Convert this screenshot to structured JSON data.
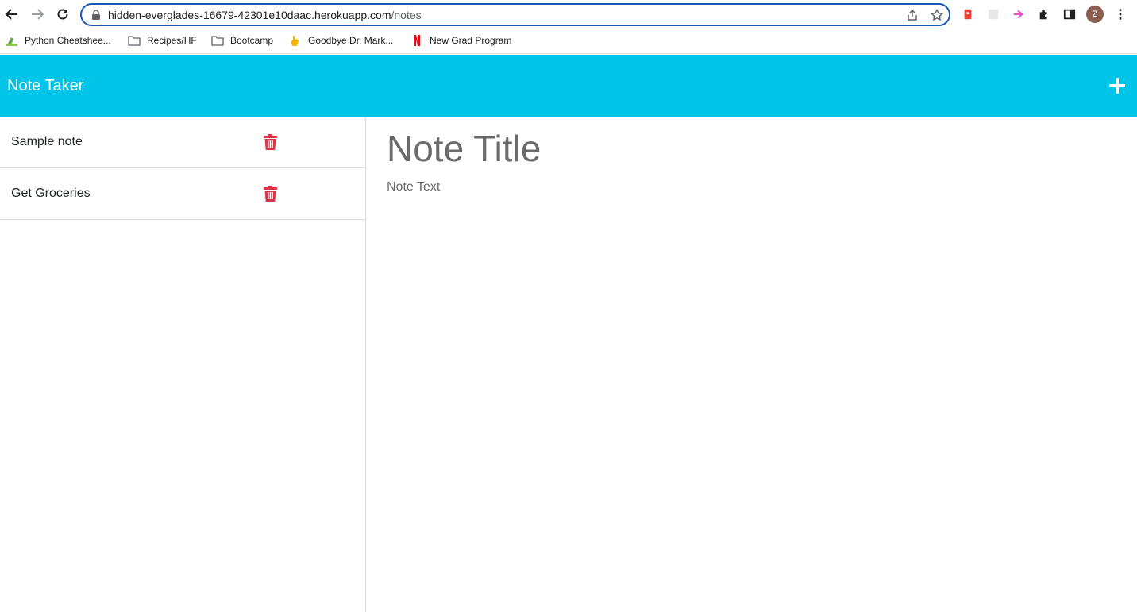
{
  "browser": {
    "url_host": "hidden-everglades-16679-42301e10daac.herokuapp.com",
    "url_path": "/notes",
    "profile_initial": "Z",
    "bookmarks": [
      {
        "label": "Python Cheatshee...",
        "icon": "python-icon"
      },
      {
        "label": "Recipes/HF",
        "icon": "folder-icon"
      },
      {
        "label": "Bootcamp",
        "icon": "folder-icon"
      },
      {
        "label": "Goodbye Dr. Mark...",
        "icon": "hand-icon"
      },
      {
        "label": "New Grad Program",
        "icon": "netflix-icon"
      }
    ]
  },
  "app": {
    "brand": "Note Taker",
    "accent_color": "#00c4e8",
    "delete_color": "#dc3545",
    "notes": [
      {
        "title": "Sample note"
      },
      {
        "title": "Get Groceries"
      }
    ],
    "editor": {
      "title_placeholder": "Note Title",
      "text_placeholder": "Note Text"
    }
  }
}
